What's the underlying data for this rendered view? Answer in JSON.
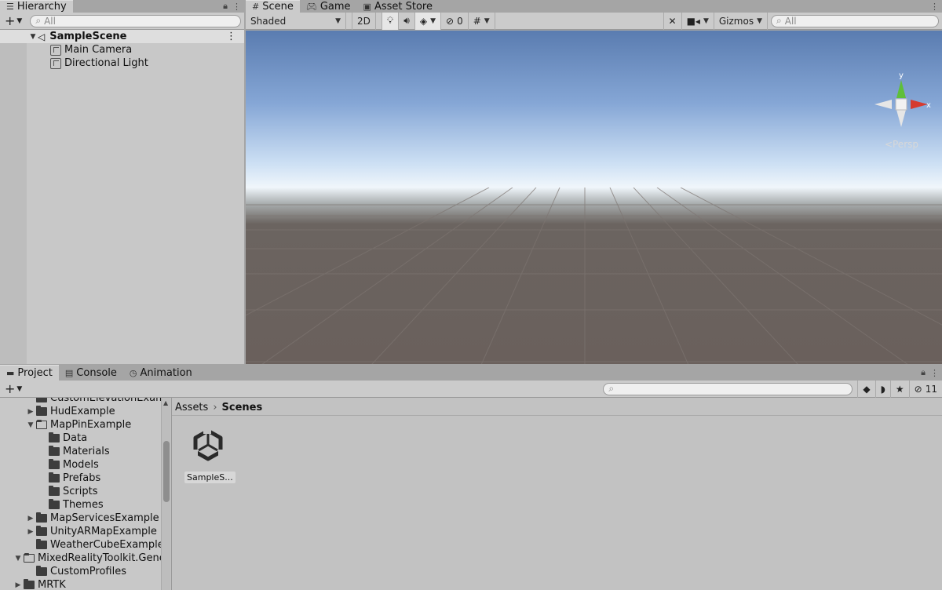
{
  "hierarchy": {
    "tab_label": "Hierarchy",
    "search_placeholder": "All",
    "scene_name": "SampleScene",
    "items": [
      "Main Camera",
      "Directional Light"
    ]
  },
  "scene": {
    "tabs": [
      {
        "label": "Scene",
        "icon": "grid-icon"
      },
      {
        "label": "Game",
        "icon": "gamepad-icon"
      },
      {
        "label": "Asset Store",
        "icon": "bag-icon"
      }
    ],
    "shading_mode": "Shaded",
    "mode_2d": "2D",
    "hidden_count": "0",
    "gizmos_label": "Gizmos",
    "search_placeholder": "All",
    "gizmo_y_label": "y",
    "gizmo_x_label": "x",
    "persp_label": "Persp"
  },
  "project": {
    "tabs": [
      {
        "label": "Project",
        "icon": "folder-icon"
      },
      {
        "label": "Console",
        "icon": "console-icon"
      },
      {
        "label": "Animation",
        "icon": "clock-icon"
      }
    ],
    "hidden_packages_count": "11",
    "breadcrumb": [
      "Assets",
      "Scenes"
    ],
    "folders": [
      {
        "label": "CustomElevationExam",
        "indent": 2,
        "arrow": ""
      },
      {
        "label": "HudExample",
        "indent": 2,
        "arrow": "right"
      },
      {
        "label": "MapPinExample",
        "indent": 2,
        "arrow": "down"
      },
      {
        "label": "Data",
        "indent": 3,
        "arrow": ""
      },
      {
        "label": "Materials",
        "indent": 3,
        "arrow": ""
      },
      {
        "label": "Models",
        "indent": 3,
        "arrow": ""
      },
      {
        "label": "Prefabs",
        "indent": 3,
        "arrow": ""
      },
      {
        "label": "Scripts",
        "indent": 3,
        "arrow": ""
      },
      {
        "label": "Themes",
        "indent": 3,
        "arrow": ""
      },
      {
        "label": "MapServicesExample",
        "indent": 2,
        "arrow": "right"
      },
      {
        "label": "UnityARMapExample",
        "indent": 2,
        "arrow": "right"
      },
      {
        "label": "WeatherCubeExample",
        "indent": 2,
        "arrow": ""
      },
      {
        "label": "MixedRealityToolkit.Gene",
        "indent": 1,
        "arrow": "down"
      },
      {
        "label": "CustomProfiles",
        "indent": 2,
        "arrow": ""
      },
      {
        "label": "MRTK",
        "indent": 1,
        "arrow": "right"
      }
    ],
    "asset_label": "SampleS..."
  },
  "colors": {
    "panel_bg": "#c8c8c8",
    "sky_top": "#5a7cb0",
    "horizon": "#f0f6fb",
    "ground": "#6a605c",
    "gizmo_y": "#5fbf3a",
    "gizmo_x": "#d63b2f"
  }
}
